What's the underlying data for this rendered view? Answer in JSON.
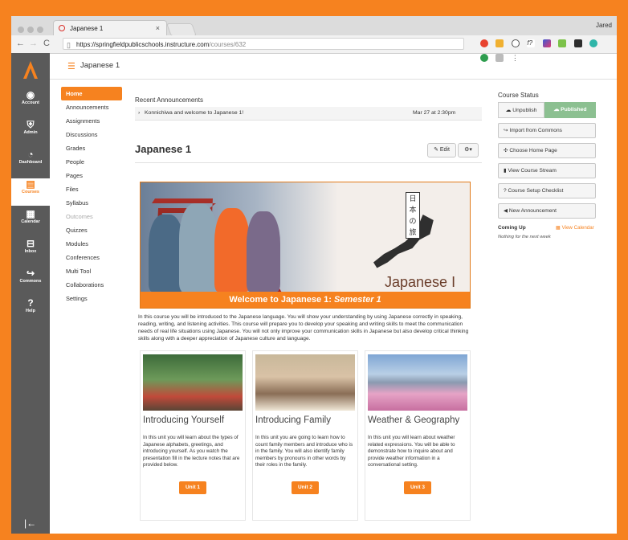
{
  "browser": {
    "tab_title": "Japanese 1",
    "tab_close": "×",
    "user_name": "Jared",
    "url_host": "https://springfieldpublicschools.instructure.com",
    "url_path": "/courses/632"
  },
  "global_nav": {
    "items": [
      {
        "label": "Account",
        "icon": "user-icon"
      },
      {
        "label": "Admin",
        "icon": "shield-icon"
      },
      {
        "label": "Dashboard",
        "icon": "dashboard-icon"
      },
      {
        "label": "Courses",
        "icon": "book-icon"
      },
      {
        "label": "Calendar",
        "icon": "calendar-icon"
      },
      {
        "label": "Inbox",
        "icon": "inbox-icon"
      },
      {
        "label": "Commons",
        "icon": "commons-icon"
      },
      {
        "label": "Help",
        "icon": "help-icon"
      }
    ],
    "collapse": "|←"
  },
  "course_header": {
    "title": "Japanese 1"
  },
  "course_nav": [
    "Home",
    "Announcements",
    "Assignments",
    "Discussions",
    "Grades",
    "People",
    "Pages",
    "Files",
    "Syllabus",
    "Outcomes",
    "Quizzes",
    "Modules",
    "Conferences",
    "Multi Tool",
    "Collaborations",
    "Settings"
  ],
  "main": {
    "recent_announcements": "Recent Announcements",
    "announcement_text": "Konnichiwa and welcome to Japanese 1!",
    "announcement_date": "Mar 27 at 2:30pm",
    "page_title": "Japanese 1",
    "edit_label": "Edit",
    "banner_caption_prefix": "Welcome to Japanese 1: ",
    "banner_caption_em": "Semester 1",
    "banner_jp": "Japanese I",
    "banner_kanji": "日本の旅",
    "intro": "In this course you will be introduced to the Japanese language. You will show your understanding by using Japanese correctly in speaking, reading, writing, and listening activities. This course will prepare you to develop your speaking and writing skills to meet the communication needs of real life situations using Japanese. You will not only improve your communication skills in Japanese but also develop critical thinking skills along with a deeper appreciation of Japanese culture and language.",
    "units": [
      {
        "title": "Introducing Yourself",
        "desc": "In this unit you will learn about the types of Japanese alphabets, greetings, and introducing yourself. As you watch the presentation fill in the lecture notes that are provided below.",
        "button": "Unit 1"
      },
      {
        "title": "Introducing Family",
        "desc": "In this unit you are going to learn how to count family members and introduce who is in the family. You will also identify family members by pronouns in other words by their roles in the family.",
        "button": "Unit 2"
      },
      {
        "title": "Weather & Geography",
        "desc": "In this unit you will learn about weather related expressions. You will be able to demonstrate how to inquire about and provide weather information in a conversational setting.",
        "button": "Unit 3"
      }
    ]
  },
  "sidebar": {
    "course_status": "Course Status",
    "unpublish": "Unpublish",
    "published": "Published",
    "buttons": [
      "Import from Commons",
      "Choose Home Page",
      "View Course Stream",
      "Course Setup Checklist",
      "New Announcement"
    ],
    "coming_up": "Coming Up",
    "view_calendar": "View Calendar",
    "nothing": "Nothing for the next week"
  },
  "colors": {
    "accent": "#f6821f",
    "published": "#8cc091",
    "nav_bg": "#5a5a5a"
  }
}
